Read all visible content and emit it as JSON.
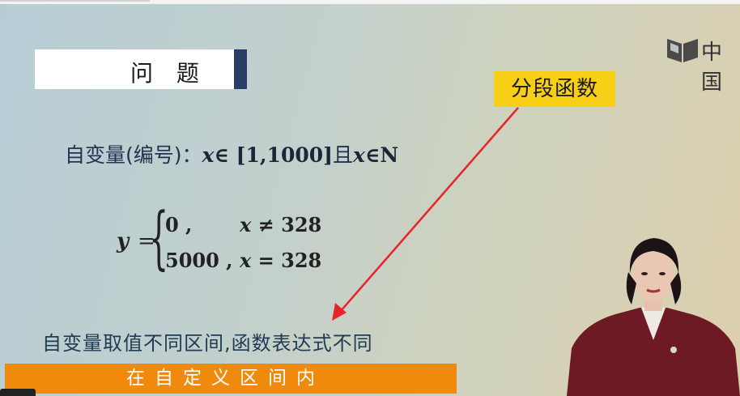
{
  "slide": {
    "title": "问 题",
    "logo_text": "中国",
    "tag": "分段函数",
    "domain": {
      "label": "自变量(编号)：",
      "var1": "x",
      "set1": "∈ [1,1000]",
      "conj": "且",
      "var2": "x",
      "set2": "∈N"
    },
    "formula": {
      "lhs": "y",
      "eq": "=",
      "brace": "{",
      "case1_value": "0 ,",
      "case1_var": "x",
      "case1_cond": " ≠ 328",
      "case2_value": "5000 ,",
      "case2_var": "x",
      "case2_cond": " = 328"
    },
    "note": "自变量取值不同区间,函数表达式不同",
    "banner": "在自定义区间内"
  },
  "colors": {
    "tag_bg": "#f6cf16",
    "banner_bg": "#f08a0c",
    "title_accent": "#2a3d66",
    "arrow": "#e8242a"
  },
  "icons": {
    "logo": "book-logo-icon"
  }
}
